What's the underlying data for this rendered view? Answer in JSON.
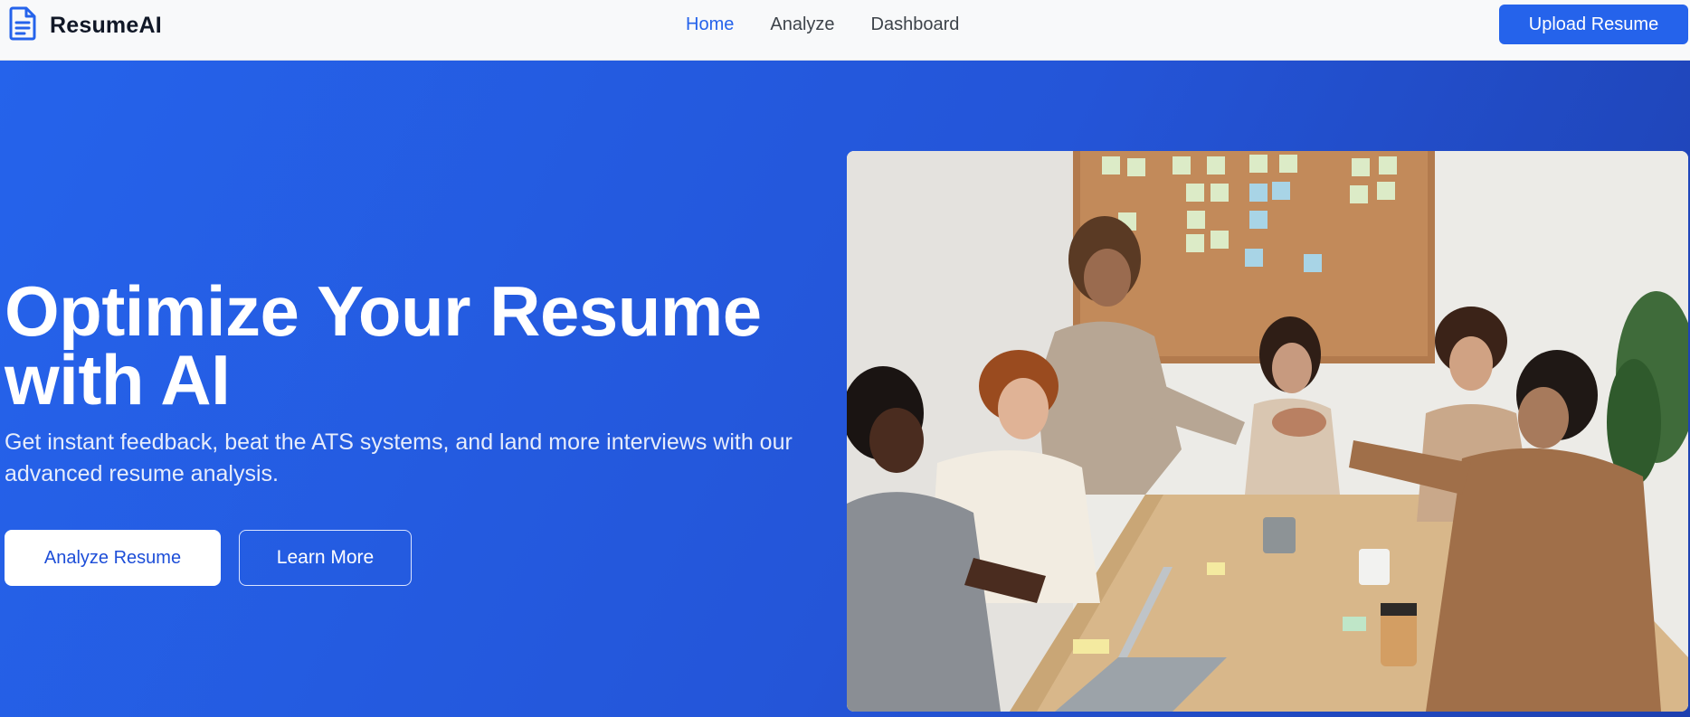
{
  "brand": {
    "name": "ResumeAI",
    "icon": "document-icon",
    "icon_color": "#2563eb"
  },
  "nav": {
    "links": [
      {
        "label": "Home",
        "active": true
      },
      {
        "label": "Analyze",
        "active": false
      },
      {
        "label": "Dashboard",
        "active": false
      }
    ],
    "cta_label": "Upload Resume"
  },
  "hero": {
    "title": "Optimize Your Resume with AI",
    "subtitle": "Get instant feedback, beat the ATS systems, and land more interviews with our advanced resume analysis.",
    "primary_button": "Analyze Resume",
    "secondary_button": "Learn More",
    "image": "team-meeting-photo"
  },
  "colors": {
    "accent": "#2563eb",
    "hero_gradient_start": "#2563eb",
    "hero_gradient_end": "#1e40af",
    "nav_background": "#f8f9fa"
  }
}
